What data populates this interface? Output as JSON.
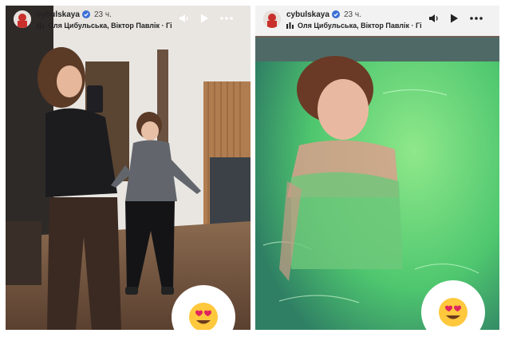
{
  "stories": [
    {
      "username": "cybulskaya",
      "time_ago": "23 ч.",
      "music_label": "Оля Цибульська, Віктор Павлік · Гі",
      "icons": {
        "sound": "speaker-icon",
        "play": "play-icon",
        "more": "more-icon",
        "verified": "verified-badge-icon",
        "music": "music-bars-icon"
      },
      "reaction_emoji": "heart-eyes-emoji-icon"
    },
    {
      "username": "cybulskaya",
      "time_ago": "23 ч.",
      "music_label": "Оля Цибульська, Віктор Павлік · Гі",
      "icons": {
        "sound": "speaker-icon",
        "play": "play-icon",
        "more": "more-icon",
        "verified": "verified-badge-icon",
        "music": "music-bars-icon"
      },
      "reaction_emoji": "heart-eyes-emoji-icon"
    }
  ],
  "colors": {
    "verified_badge": "#3b6fd6",
    "emoji_face": "#ffc83d",
    "emoji_hearts": "#e0245e",
    "pool_water": "#5fd48a"
  }
}
